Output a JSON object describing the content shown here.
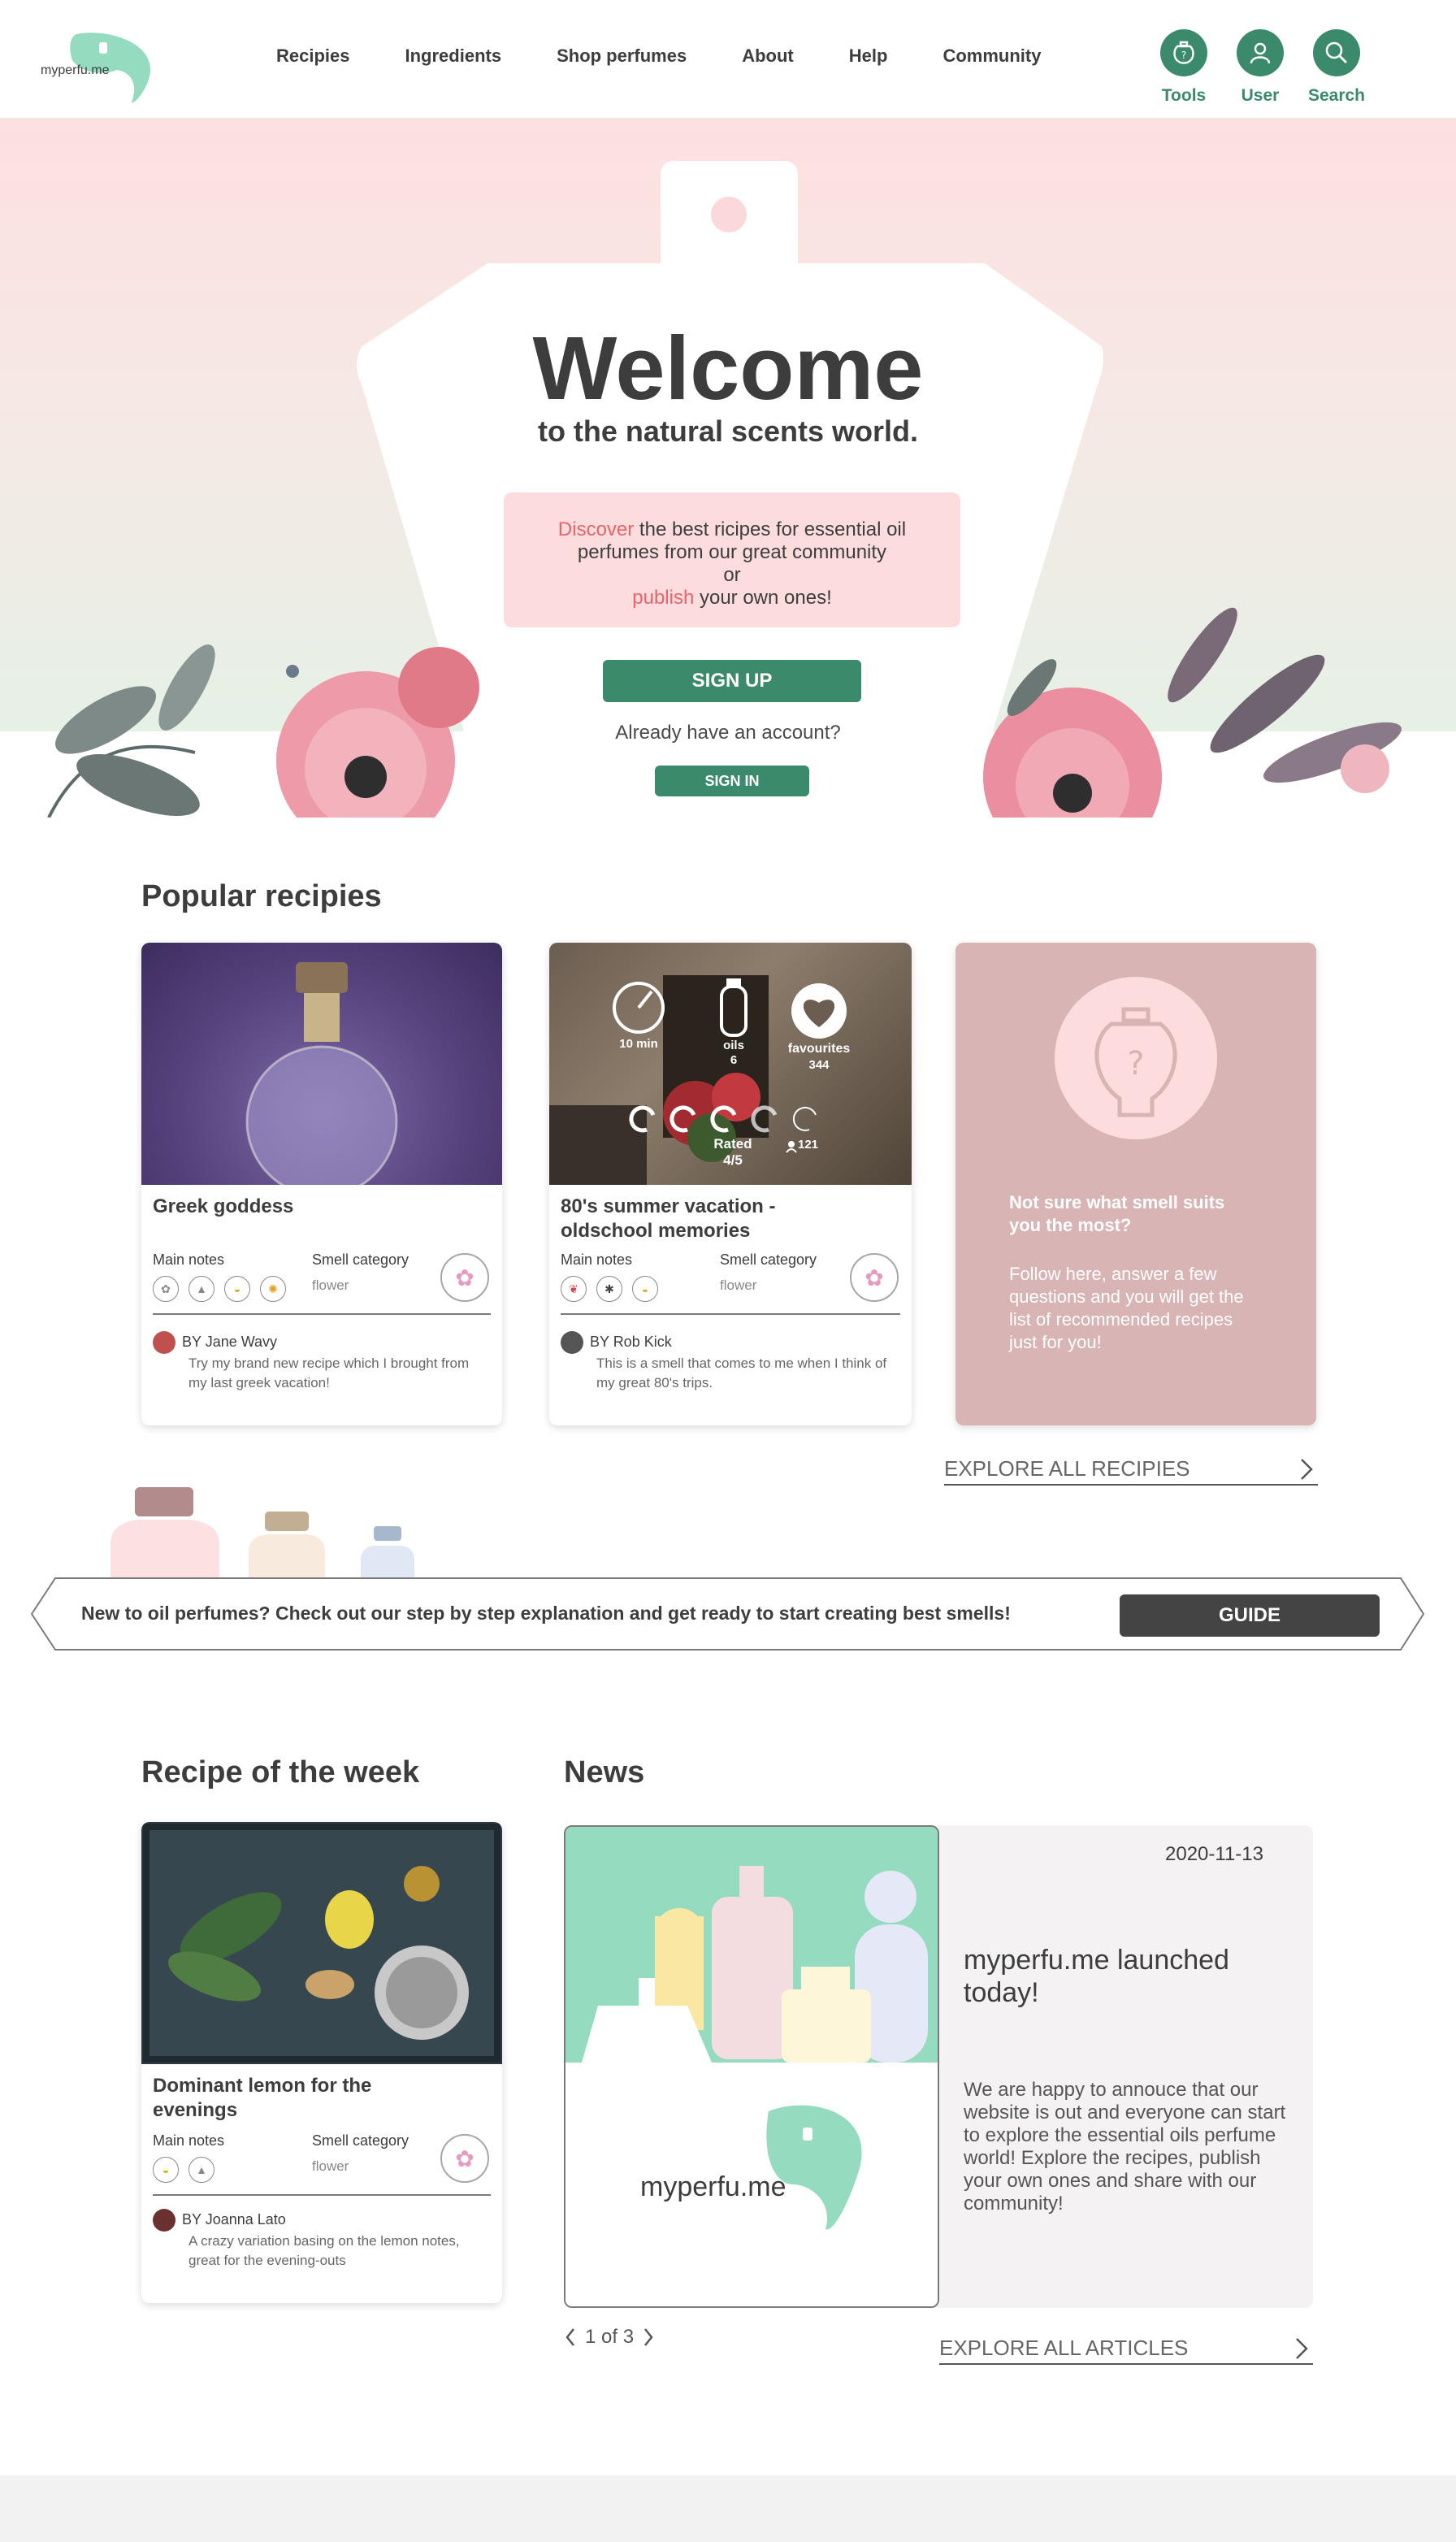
{
  "header": {
    "logo_text": "myperfu.me",
    "nav": [
      "Recipies",
      "Ingredients",
      "Shop perfumes",
      "About",
      "Help",
      "Community"
    ],
    "tools_label": "Tools",
    "user_label": "User",
    "search_label": "Search"
  },
  "hero": {
    "title": "Welcome",
    "subtitle": "to the natural scents world.",
    "discover_word": "Discover",
    "discover_line1_rest": " the best ricipes for essential oil",
    "discover_line2": "perfumes from our great community",
    "discover_or": "or",
    "publish_word": "publish",
    "publish_rest": " your own ones!",
    "signup_label": "SIGN UP",
    "already_text": "Already have an account?",
    "signin_label": "SIGN IN"
  },
  "popular": {
    "title": "Popular recipies",
    "main_notes_label": "Main notes",
    "smell_category_label": "Smell category",
    "cards": [
      {
        "title": "Greek goddess",
        "smell_category": "flower",
        "author": "BY Jane Wavy",
        "description": "Try my brand new recipe which I brought from my last greek vacation!"
      },
      {
        "title_line1": "80's summer vacation -",
        "title_line2": "oldschool memories",
        "smell_category": "flower",
        "author": "BY Rob Kick",
        "description": "This is a smell that comes to me when I think of my great 80's trips.",
        "overlay": {
          "time": "10 min",
          "oils_label": "oils",
          "oils_value": "6",
          "favourites_label": "favourites",
          "favourites_value": "344",
          "rated_label": "Rated",
          "rated_value": "4/5",
          "raters": "121"
        }
      }
    ],
    "quiz": {
      "title_line1": "Not sure what smell suits",
      "title_line2": "you the most?",
      "body": "Follow here, answer a few questions and you will get the list of recommended recipes just for you!"
    },
    "explore_label": "EXPLORE ALL RECIPIES"
  },
  "guide": {
    "text": "New to oil perfumes? Check out our step by step explanation and get ready to start creating best  smells!",
    "button_label": "GUIDE"
  },
  "recipe_week": {
    "title": "Recipe of the week",
    "card_title_line1": "Dominant lemon for the",
    "card_title_line2": "evenings",
    "main_notes_label": "Main notes",
    "smell_category_label": "Smell category",
    "smell_category": "flower",
    "author": "BY Joanna Lato",
    "description": "A crazy variation basing on the lemon notes, great for the evening-outs"
  },
  "news": {
    "title": "News",
    "date": "2020-11-13",
    "headline": "myperfu.me launched today!",
    "body": "We are happy to annouce that our website is out and everyone can start to explore the essential oils perfume world! Explore the recipes, publish your own ones and share with our community!",
    "logo_text": "myperfu.me",
    "pager": "1 of 3",
    "explore_label": "EXPLORE ALL ARTICLES"
  },
  "colors": {
    "brand_green": "#3c8a6c",
    "accent_pink": "#e8636b",
    "mint": "#95dbc0",
    "quiz_bg": "#d8b4b4"
  }
}
